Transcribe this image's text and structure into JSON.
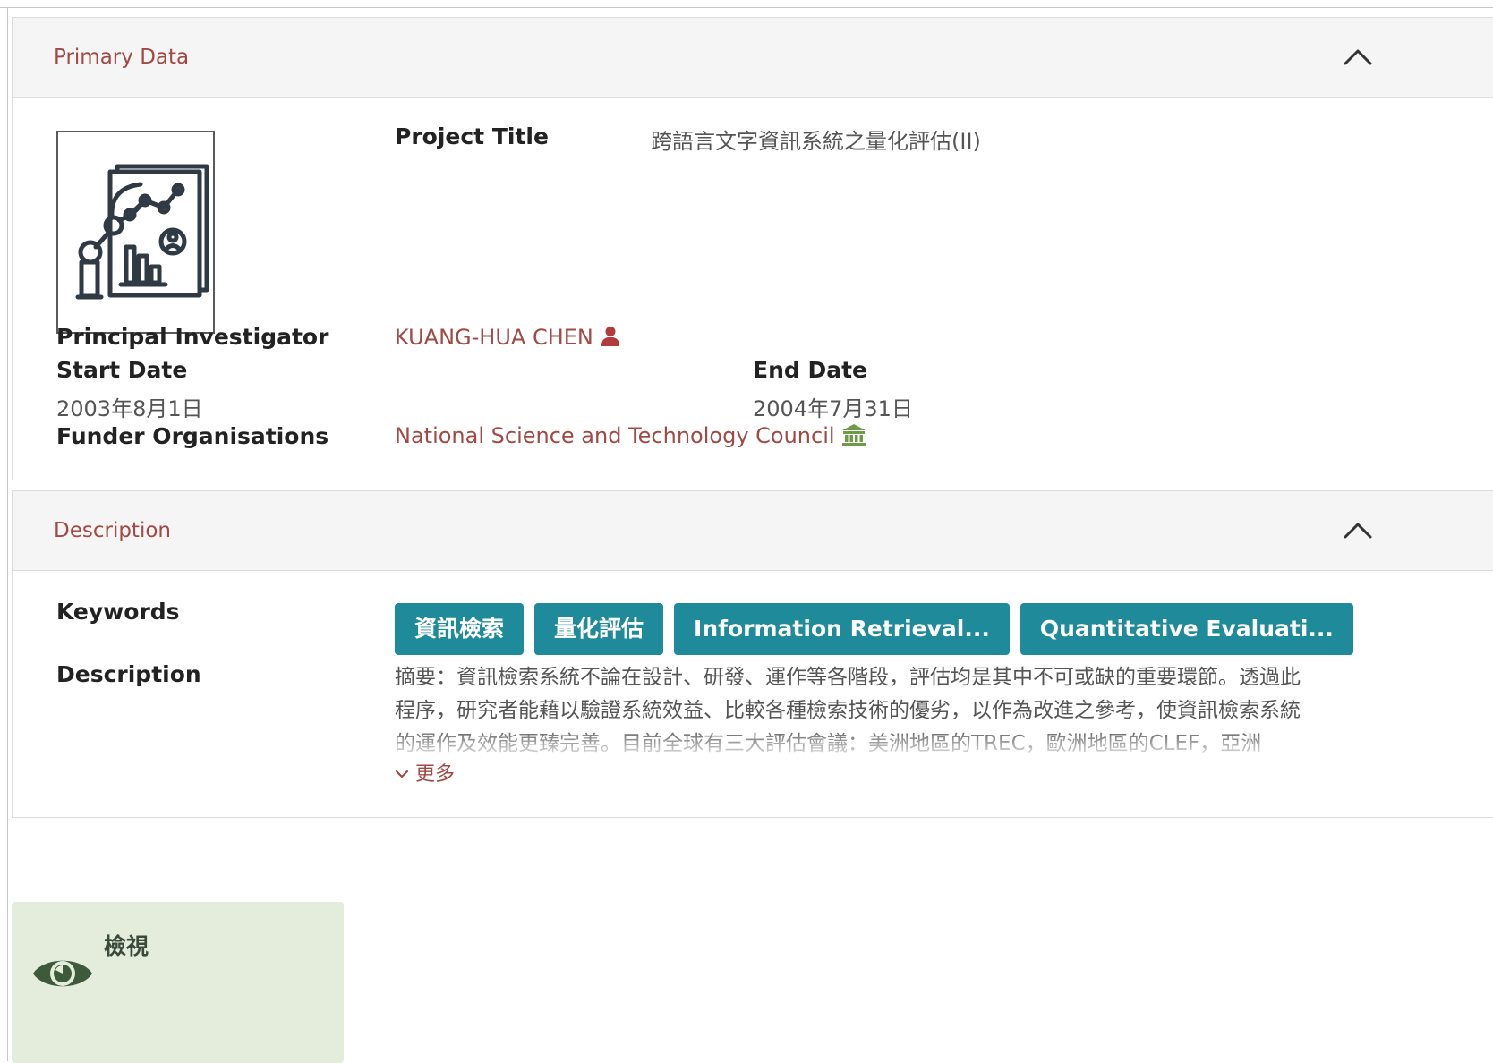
{
  "primary": {
    "section_title": "Primary Data",
    "collapse_icon": "chevron-up-icon",
    "thumbnail_icon": "data-analysis-icon",
    "project_title_label": "Project Title",
    "project_title_value": "跨語言文字資訊系統之量化評估(II)",
    "pi_label": "Principal Investigator",
    "pi_name": "KUANG-HUA CHEN",
    "pi_icon": "person-icon",
    "start_label": "Start Date",
    "start_value": "2003年8月1日",
    "end_label": "End Date",
    "end_value": "2004年7月31日",
    "funder_label": "Funder Organisations",
    "funder_value": "National Science and Technology Council",
    "funder_icon": "institution-icon",
    "accent_color": "#a14a45",
    "funder_icon_color": "#6f9a46"
  },
  "description": {
    "section_title": "Description",
    "collapse_icon": "chevron-up-icon",
    "keywords_label": "Keywords",
    "keywords": [
      "資訊檢索",
      "量化評估",
      "Information Retrieval...",
      "Quantitative Evaluati..."
    ],
    "tag_color": "#1e8a9a",
    "description_label": "Description",
    "text_lines": [
      "摘要：資訊檢索系統不論在設計、研發、運作等各階段，評估均是其中不可或缺的重要環節。透過此",
      "程序，研究者能藉以驗證系統效益、比較各種檢索技術的優劣，以作為改進之參考，使資訊檢索系統",
      "的運作及效能更臻完善。目前全球有三大評估會議：美洲地區的TREC，歐洲地區的CLEF，亞洲"
    ],
    "more_label": "更多",
    "more_icon": "chevron-down-icon"
  },
  "view": {
    "label": "檢視",
    "icon": "eye-icon",
    "card_color": "#e4ecdc",
    "icon_color": "#3d5a3a"
  }
}
